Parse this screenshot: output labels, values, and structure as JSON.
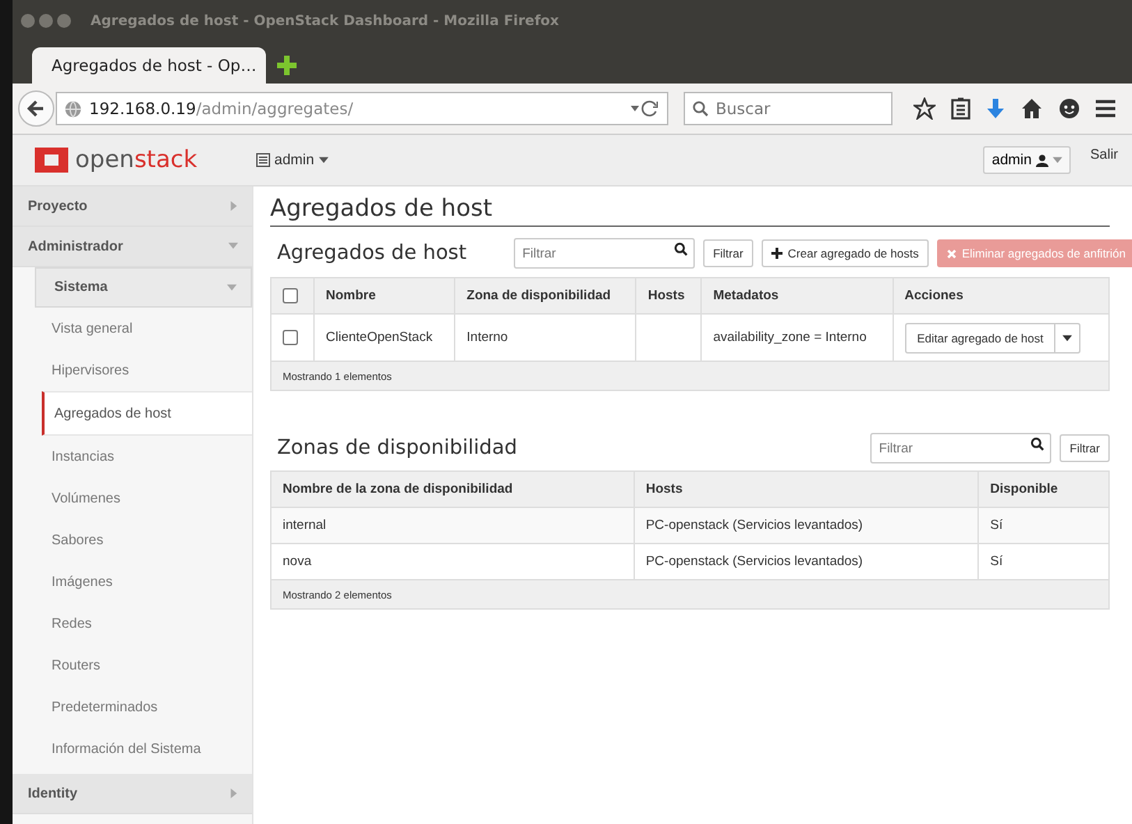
{
  "window": {
    "title": "Agregados de host - OpenStack Dashboard - Mozilla Firefox"
  },
  "tabs": [
    {
      "label": "Agregados de host - Op…",
      "selected": true
    }
  ],
  "address": {
    "host": "192.168.0.19",
    "path": "/admin/aggregates/"
  },
  "search": {
    "placeholder": "Buscar"
  },
  "header": {
    "logo": {
      "prefix": "open",
      "suffix": "stack"
    },
    "project": "admin",
    "user": "admin",
    "logout": "Salir"
  },
  "sidebar": [
    {
      "label": "Proyecto",
      "expanded": false
    },
    {
      "label": "Administrador",
      "expanded": true,
      "children": [
        {
          "label": "Sistema",
          "expanded": true,
          "children": [
            {
              "label": "Vista general",
              "selected": false
            },
            {
              "label": "Hipervisores",
              "selected": false
            },
            {
              "label": "Agregados de host",
              "selected": true
            },
            {
              "label": "Instancias",
              "selected": false
            },
            {
              "label": "Volúmenes",
              "selected": false
            },
            {
              "label": "Sabores",
              "selected": false
            },
            {
              "label": "Imágenes",
              "selected": false
            },
            {
              "label": "Redes",
              "selected": false
            },
            {
              "label": "Routers",
              "selected": false
            },
            {
              "label": "Predeterminados",
              "selected": false
            },
            {
              "label": "Información del Sistema",
              "selected": false
            }
          ]
        }
      ]
    },
    {
      "label": "Identity",
      "expanded": false
    }
  ],
  "page_title": "Agregados de host",
  "aggregates": {
    "title": "Agregados de host",
    "filter": {
      "placeholder": "Filtrar"
    },
    "filter_button": "Filtrar",
    "create_button": "Crear agregado de hosts",
    "delete_button": {
      "label": "Eliminar agregados de anfitrión",
      "disabled": true
    },
    "select_all": {
      "checked": false
    },
    "columns": [
      "Nombre",
      "Zona de disponibilidad",
      "Hosts",
      "Metadatos",
      "Acciones"
    ],
    "rows": [
      {
        "checked": false,
        "cells": [
          "ClienteOpenStack",
          "Interno",
          "",
          "availability_zone = Interno"
        ],
        "action": "Editar agregado de host"
      }
    ],
    "footer": "Mostrando 1 elementos"
  },
  "zones": {
    "title": "Zonas de disponibilidad",
    "filter": {
      "placeholder": "Filtrar"
    },
    "filter_button": "Filtrar",
    "columns": [
      "Nombre de la zona de disponibilidad",
      "Hosts",
      "Disponible"
    ],
    "rows": [
      [
        "internal",
        "PC-openstack (Servicios levantados)",
        "Sí"
      ],
      [
        "nova",
        "PC-openstack (Servicios levantados)",
        "Sí"
      ]
    ],
    "footer": "Mostrando 2 elementos"
  }
}
